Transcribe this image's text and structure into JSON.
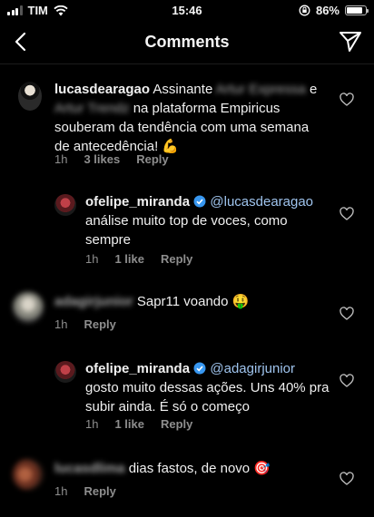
{
  "status": {
    "carrier": "TIM",
    "time": "15:46",
    "battery": "86%",
    "battery_level": 0.86
  },
  "header": {
    "title": "Comments"
  },
  "comments": [
    {
      "user": "lucasdearagao",
      "text_a": "Assinante",
      "blur_a": "Artur Expressa",
      "text_b": "e",
      "blur_b": "Artur Trendz",
      "text_c": "na plataforma Empiricus souberam da tendência com uma semana de antecedência! 💪",
      "time": "1h",
      "likes": "3 likes",
      "reply": "Reply"
    },
    {
      "user": "ofelipe_miranda",
      "mention": "@lucasdearagao",
      "text": "análise muito top de voces, como sempre",
      "time": "1h",
      "likes": "1 like",
      "reply": "Reply"
    },
    {
      "user": "adagirjunior",
      "text": "Sapr11 voando 🤑",
      "time": "1h",
      "reply": "Reply"
    },
    {
      "user": "ofelipe_miranda",
      "mention": "@adagirjunior",
      "text": "gosto muito dessas ações. Uns 40% pra subir ainda. É só o começo",
      "time": "1h",
      "likes": "1 like",
      "reply": "Reply"
    },
    {
      "user": "lucasdlima",
      "text": "dias fastos, de novo 🎯",
      "time": "1h",
      "reply": "Reply"
    }
  ]
}
